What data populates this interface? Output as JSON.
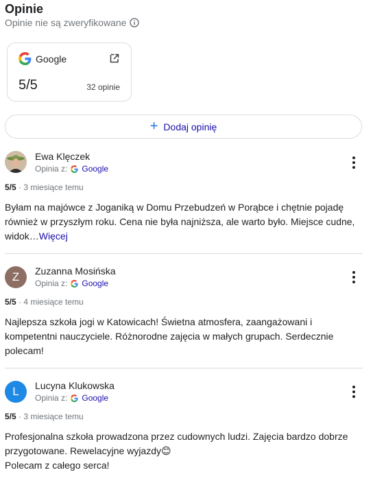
{
  "header": {
    "title": "Opinie",
    "subtitle": "Opinie nie są zweryfikowane"
  },
  "source_card": {
    "name": "Google",
    "score": "5/5",
    "count": "32 opinie"
  },
  "add_review_label": "Dodaj opinię",
  "reviews": [
    {
      "author": "Ewa Klęczek",
      "via_prefix": "Opinia z:",
      "via_source": "Google",
      "rating": "5/5",
      "time": " · 3 miesiące temu",
      "text": "Byłam na majówce z Joganiką w Domu Przebudzeń w Porąbce i chętnie pojadę\nrównież w przyszłym roku. Cena nie była najniższa, ale warto było. Miejsce cudne,\nwidok…",
      "more_label": "Więcej"
    },
    {
      "author": "Zuzanna Mosińska",
      "avatar_letter": "Z",
      "avatar_color": "#8d6e63",
      "via_prefix": "Opinia z:",
      "via_source": "Google",
      "rating": "5/5",
      "time": " · 4 miesiące temu",
      "text": "Najlepsza szkoła jogi w Katowicach! Świetna atmosfera, zaangażowani i\nkompetentni nauczyciele. Różnorodne zajęcia w małych grupach. Serdecznie\npolecam!"
    },
    {
      "author": "Lucyna Klukowska",
      "avatar_letter": "L",
      "avatar_color": "#1e88e5",
      "via_prefix": "Opinia z:",
      "via_source": "Google",
      "rating": "5/5",
      "time": " · 3 miesiące temu",
      "text": "Profesjonalna szkoła prowadzona przez cudownych ludzi. Zajęcia bardzo dobrze\nprzygotowane. Rewelacyjne wyjazdy😊\nPolecam z całego serca!"
    }
  ]
}
